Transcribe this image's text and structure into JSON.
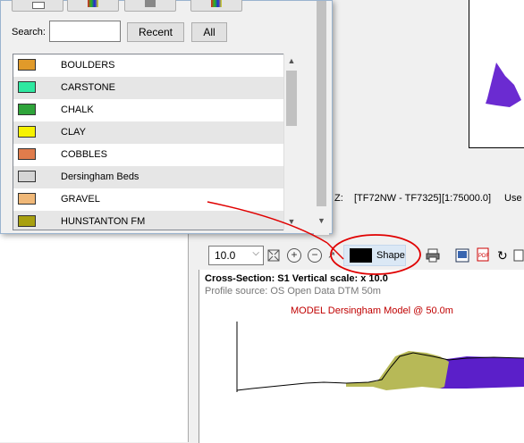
{
  "dialog": {
    "search_label": "Search:",
    "search_value": "",
    "recent_label": "Recent",
    "all_label": "All",
    "items": [
      {
        "label": "BOULDERS",
        "color": "#e09a2a"
      },
      {
        "label": "CARSTONE",
        "color": "#2ee8a0"
      },
      {
        "label": "CHALK",
        "color": "#2ea43a"
      },
      {
        "label": "CLAY",
        "color": "#f7f200"
      },
      {
        "label": "COBBLES",
        "color": "#e07c4c"
      },
      {
        "label": "Dersingham Beds",
        "color": "#d4d4d4"
      },
      {
        "label": "GRAVEL",
        "color": "#f0b878"
      },
      {
        "label": "HUNSTANTON FM",
        "color": "#a8a010"
      }
    ]
  },
  "statusbar": {
    "prefix": "Z:",
    "sheet": "[TF72NW - TF7325]",
    "scale": "[1:75000.0]",
    "trailing": "Use S"
  },
  "toolbar": {
    "zoom_value": "10.0",
    "shape_label": "Shape",
    "shape_color": "#000000"
  },
  "cross_section": {
    "title": "Cross-Section: S1   Vertical scale: x 10.0",
    "source": "Profile source: OS Open Data DTM 50m",
    "model": "MODEL Dersingham Model @ 50.0m",
    "colors": {
      "upper_unit": "#b7b957",
      "lower_unit": "#5b1fc9",
      "map_unit": "#6b2bd1"
    }
  }
}
